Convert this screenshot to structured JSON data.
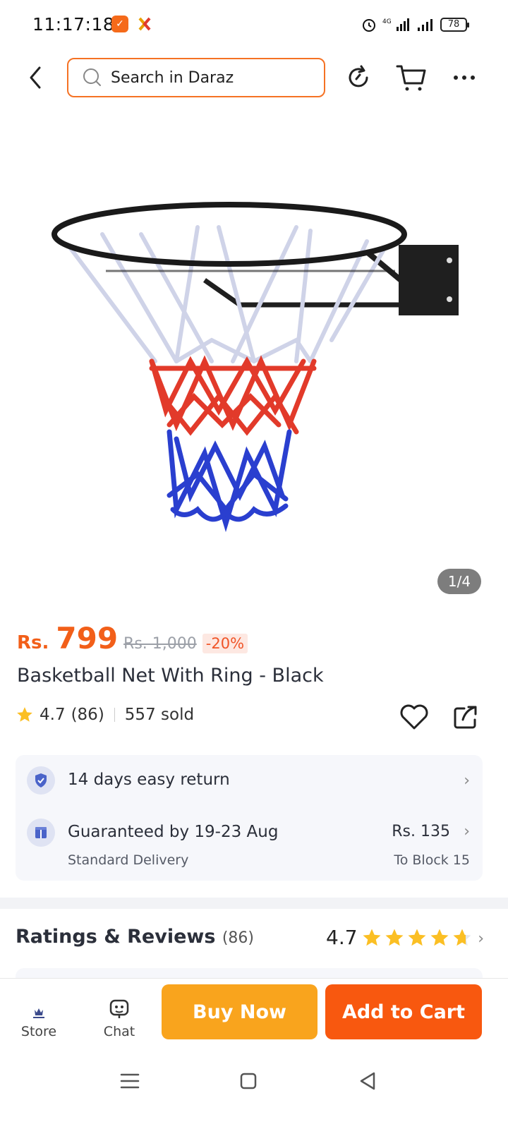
{
  "status": {
    "time": "11:17:18",
    "app_icon_1": "daraz-notification-icon",
    "app_icon_2": "app-notification-icon",
    "network": "4G",
    "battery": "78"
  },
  "header": {
    "search_placeholder": "Search in Daraz",
    "icons": [
      "back-arrow-icon",
      "search-icon",
      "refresh-icon",
      "cart-icon",
      "more-icon"
    ]
  },
  "gallery": {
    "page_indicator": "1/4"
  },
  "product": {
    "currency": "Rs.",
    "price": "799",
    "original_price": "Rs. 1,000",
    "discount": "-20%",
    "title": "Basketball Net With Ring - Black",
    "rating": "4.7",
    "rating_count": "(86)",
    "sold": "557 sold"
  },
  "services": {
    "returns": "14 days easy return",
    "delivery_title": "Guaranteed by 19-23 Aug",
    "delivery_type": "Standard Delivery",
    "delivery_fee": "Rs. 135",
    "delivery_to": "To Block 15"
  },
  "reviews": {
    "title": "Ratings & Reviews",
    "count": "(86)",
    "score": "4.7",
    "stars_value": 4.7
  },
  "bottom_bar": {
    "store_label": "Store",
    "chat_label": "Chat",
    "buy_now": "Buy Now",
    "add_to_cart": "Add to Cart"
  },
  "colors": {
    "accent": "#f57224",
    "buy_now": "#f9a41d",
    "add_to_cart": "#f8580f",
    "star": "#fbbf24"
  }
}
